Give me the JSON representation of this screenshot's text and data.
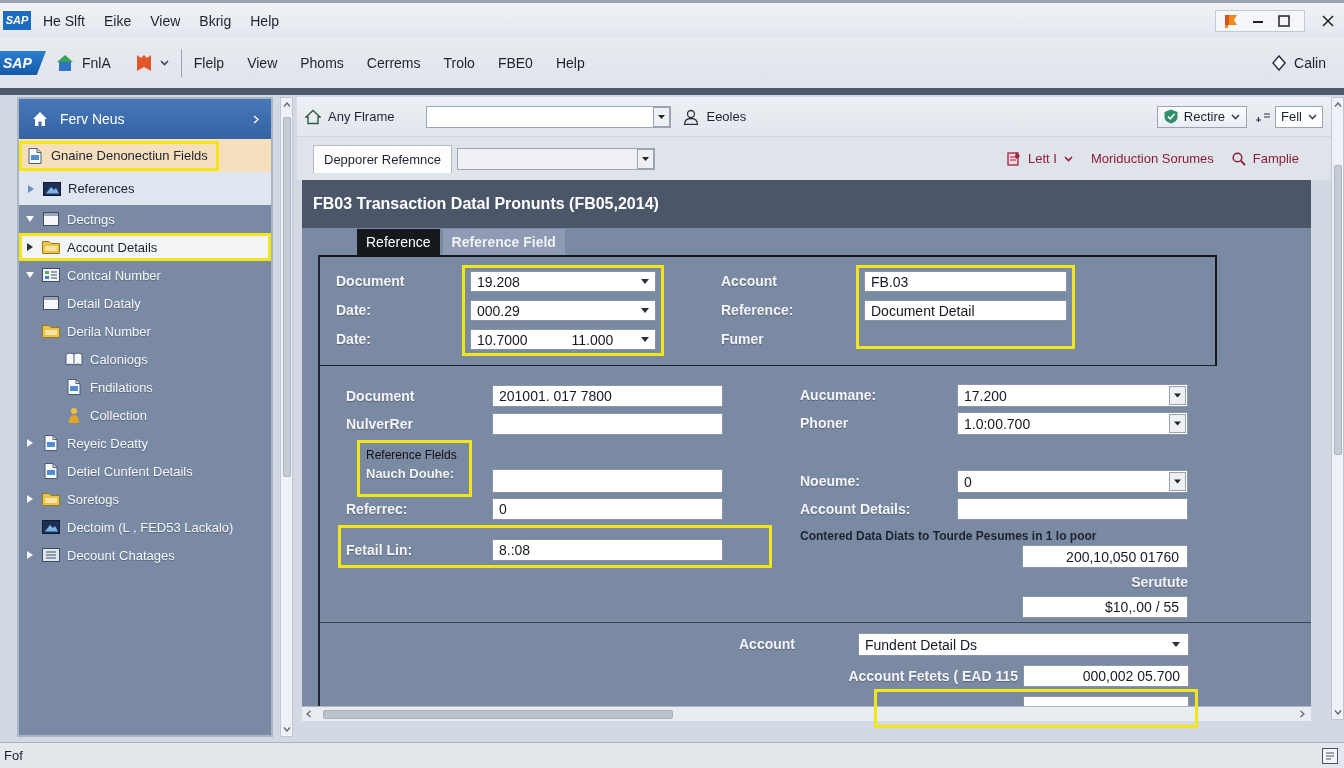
{
  "menu_bar": {
    "logo": "SAP",
    "items": [
      "He Slft",
      "Eike",
      "View",
      "Bkrig",
      "Help"
    ]
  },
  "toolbar": {
    "logo": "SAP",
    "app_label": "FnlA",
    "items": [
      "Flelp",
      "View",
      "Phoms",
      "Cerrems",
      "Trolo",
      "FBE0",
      "Help"
    ],
    "user": "Calin"
  },
  "sidebar": {
    "title": "Ferv Neus",
    "pinned": [
      {
        "label": "Gnaine Denonectiun Fields",
        "selected": true,
        "highlighted": true
      },
      {
        "label": "References",
        "selected": false,
        "highlighted": false,
        "expanded": false
      }
    ],
    "tree": [
      {
        "label": "Dectngs",
        "expanded": true,
        "selected": false,
        "highlighted": false
      },
      {
        "label": "Account Details",
        "expanded": false,
        "selected": true,
        "highlighted": true
      },
      {
        "label": "Contcal Number",
        "expanded": true,
        "selected": false,
        "highlighted": false
      },
      {
        "label": "Detail Dataly",
        "selected": false,
        "highlighted": false
      },
      {
        "label": "Derila Number",
        "selected": false,
        "highlighted": false,
        "children": [
          {
            "label": "Caloniogs",
            "selected": false,
            "highlighted": false
          },
          {
            "label": "Fndilations",
            "selected": false,
            "highlighted": false
          },
          {
            "label": "Collection",
            "selected": false,
            "highlighted": false
          }
        ]
      },
      {
        "label": "Reyeic Deatty",
        "expanded": false,
        "selected": false,
        "highlighted": false
      },
      {
        "label": "Detiel Cunfent Details",
        "selected": false,
        "highlighted": false
      },
      {
        "label": "Soretogs",
        "expanded": false,
        "selected": false,
        "highlighted": false
      },
      {
        "label": "Dectoim (L , FED53 Lackalo)",
        "selected": false,
        "highlighted": false
      },
      {
        "label": "Decount Chatages",
        "expanded": false,
        "selected": false,
        "highlighted": false
      }
    ]
  },
  "content_toolbar": {
    "home_label": "Any Flrame",
    "roles_label": "Eeoles",
    "action_button": "Rectire",
    "view_select": "Fell"
  },
  "reference_bar": {
    "tab_label": "Depporer Refemnce",
    "menu_label": "Lett I",
    "link": "Moriduction Sorumes",
    "search_label": "Famplie"
  },
  "form_title": "FB03 Transaction Datal Pronunts (FB05,2014)",
  "tabs": [
    {
      "label": "Reference",
      "selected": true
    },
    {
      "label": "Reference Field",
      "selected": false
    }
  ],
  "header_fields": {
    "left": {
      "highlighted": true,
      "rows": [
        {
          "kind": "select",
          "label": "Document",
          "value": "19.208"
        },
        {
          "kind": "select",
          "label": "Date:",
          "value": "000.29"
        },
        {
          "kind": "select",
          "label": "Date:",
          "value": "10.7000",
          "second_value": "11.000"
        }
      ]
    },
    "right": {
      "highlighted": true,
      "rows": [
        {
          "kind": "text",
          "label": "Account",
          "value": "FB.03"
        },
        {
          "kind": "text",
          "label": "Reference:",
          "value": "Document Detail"
        },
        {
          "kind": "label",
          "label": "Fumer"
        }
      ]
    }
  },
  "detail_rows": [
    {
      "left": {
        "kind": "text",
        "label": "Document",
        "value": "201001. 017 7800",
        "highlighted": false
      },
      "right": {
        "kind": "select",
        "label": "Aucumane:",
        "value": "17.200",
        "highlighted": false
      }
    },
    {
      "left": {
        "kind": "text",
        "label": "NulverRer",
        "highlighted": false
      },
      "right": {
        "kind": "select",
        "label": "Phoner",
        "value": "1.0:00.700",
        "highlighted": false
      }
    },
    {
      "left": {
        "kind": "group",
        "title": "Reference Flelds",
        "label": "Nauch Douhe:",
        "highlighted": true
      },
      "right": {
        "kind": "select",
        "label": "Noeume:",
        "value": "0",
        "highlighted": false
      }
    },
    {
      "left": {
        "kind": "text",
        "label": "Referrec:",
        "value": "0",
        "highlighted": false
      },
      "right": {
        "kind": "text",
        "label": "Account Details:",
        "highlighted": false
      }
    },
    {
      "left": {
        "kind": "text",
        "label": "Fetail Lin:",
        "value": "8.:08",
        "highlighted": true
      },
      "right": {
        "kind": "note",
        "label": "Contered Data Diats to Tourde Pesumes in 1 lo poor",
        "value": "200,10,050 01760",
        "highlighted": false
      }
    },
    {
      "right": {
        "kind": "amount",
        "label": "Serutute",
        "value": "$10,.00 / 55",
        "highlighted": false
      }
    }
  ],
  "account_rows": [
    {
      "kind": "select",
      "label": "Account",
      "value": "Fundent Detail Ds",
      "highlighted": false
    },
    {
      "kind": "amount",
      "label": "Account Fetets ( EAD 115",
      "value": "000,002 05.700",
      "highlighted": false
    },
    {
      "kind": "blank",
      "highlighted": true
    }
  ],
  "status_bar": {
    "text": "Fof"
  }
}
